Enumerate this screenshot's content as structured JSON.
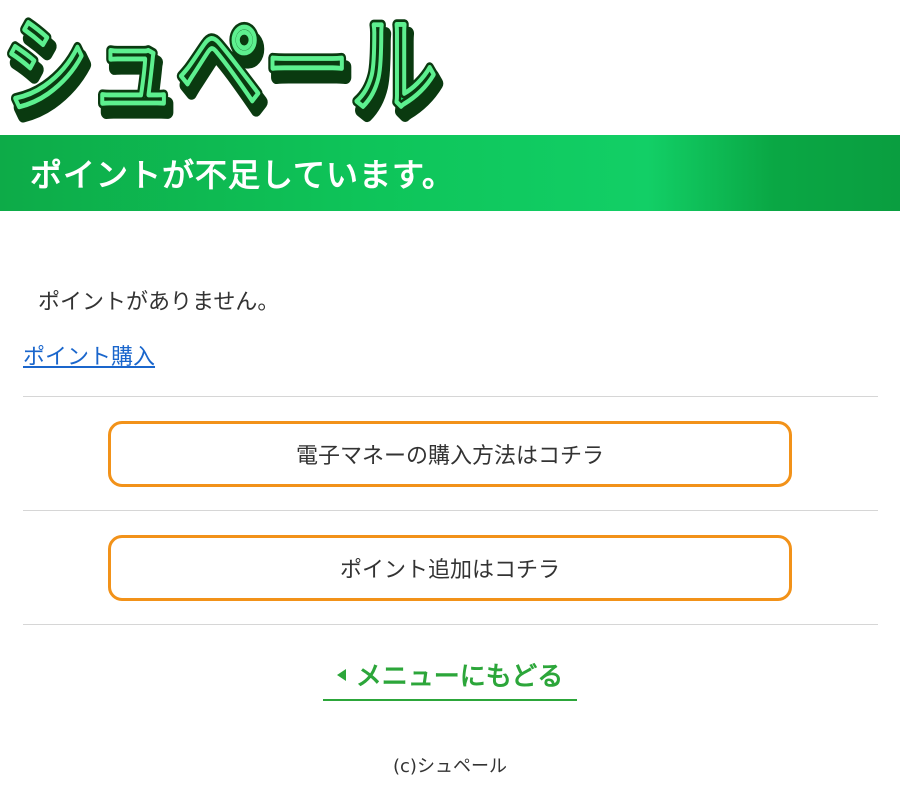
{
  "logo": {
    "text": "シュペール",
    "fill_color": "#1fe06a",
    "outline_color": "#0a3a10",
    "shadow_color": "#2e8a1e"
  },
  "banner": {
    "title": "ポイントが不足しています。",
    "color": "#0ec459"
  },
  "message": "ポイントがありません。",
  "buy_link": "ポイント購入",
  "buttons": {
    "emoney": "電子マネーの購入方法はコチラ",
    "add_points": "ポイント追加はコチラ",
    "border_color": "#f29219"
  },
  "back": {
    "label": "メニューにもどる",
    "color": "#2ca63a"
  },
  "footer": "(c)シュペール"
}
